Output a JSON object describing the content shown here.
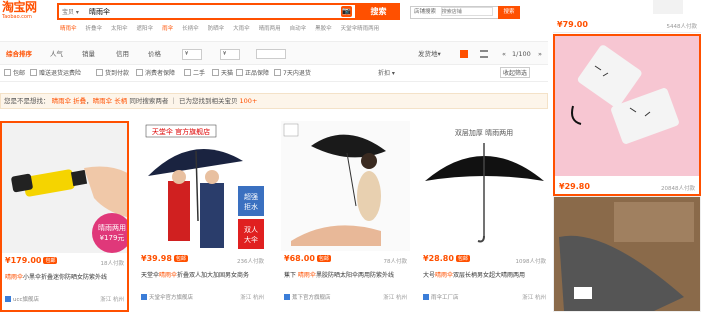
{
  "logo": {
    "title": "淘宝网",
    "subtitle": "Taobao.com"
  },
  "search": {
    "type": "宝贝",
    "query": "晴雨伞",
    "button": "搜索",
    "camera": "📷"
  },
  "hot": [
    "晴雨伞",
    "折叠伞",
    "太阳伞",
    "遮阳伞",
    "雨伞",
    "长柄伞",
    "防晒伞",
    "大雨伞",
    "晴雨两用",
    "自动伞",
    "黑胶伞",
    "天堂伞晴雨两用"
  ],
  "shop_search": {
    "label": "店铺搜索",
    "placeholder": "搜索店铺",
    "button": "搜索"
  },
  "toolbar": {
    "items": [
      "综合排序",
      "人气",
      "销量",
      "信用",
      "价格",
      "¥",
      "¥",
      "发货地",
      "«",
      "1/100",
      "»"
    ]
  },
  "filters": [
    "包邮",
    "赠送退货运费险",
    "货到付款",
    "消费者保障",
    "二手",
    "天猫",
    "正品保障",
    "7天内退货"
  ],
  "filters_right": [
    "折扣",
    "收起筛选"
  ],
  "notice": {
    "text": "您是不是想找：",
    "link1": "晴雨伞 折叠",
    "link2": "晴雨伞 长柄",
    "suffix": "同时搜索两者",
    "hint": "已为您找到相关宝贝",
    "count": "100+"
  },
  "products": [
    {
      "price": "179.00",
      "badge": "包邮",
      "deals": "18人付款",
      "title1": "",
      "keyword": "晴雨伞",
      "title2": "小黑伞折叠迷你防晒女防紫外线",
      "shop": "ucc旗舰店",
      "loc": "浙江 杭州",
      "overlay": "晴雨两用 ¥179元"
    },
    {
      "price": "39.98",
      "badge": "包邮",
      "deals": "236人付款",
      "title1": "天堂伞",
      "keyword": "晴雨伞",
      "title2": "折叠双人加大加固男女商务",
      "shop": "天堂伞官方旗舰店",
      "loc": "浙江 杭州",
      "tag": "天堂伞 官方旗舰店",
      "side": "超强 拒水",
      "side2": "双人 大伞"
    },
    {
      "price": "68.00",
      "badge": "包邮",
      "deals": "78人付款",
      "title1": "蕉下 ",
      "keyword": "晴雨伞",
      "title2": "黑胶防晒太阳伞两用防紫外线",
      "shop": "蕉下官方旗舰店",
      "loc": "浙江 杭州"
    },
    {
      "price": "28.80",
      "badge": "包邮",
      "deals": "1098人付款",
      "title1": "大号",
      "keyword": "晴雨伞",
      "title2": "双层长柄男女超大晴雨两用",
      "shop": "雨伞工厂店",
      "loc": "浙江 杭州",
      "tag": "双层加厚 晴雨两用"
    }
  ],
  "right": {
    "top_price": "79.00",
    "top_deals": "5448人付款",
    "card_price": "29.80",
    "card_deals": "20848人付款"
  }
}
